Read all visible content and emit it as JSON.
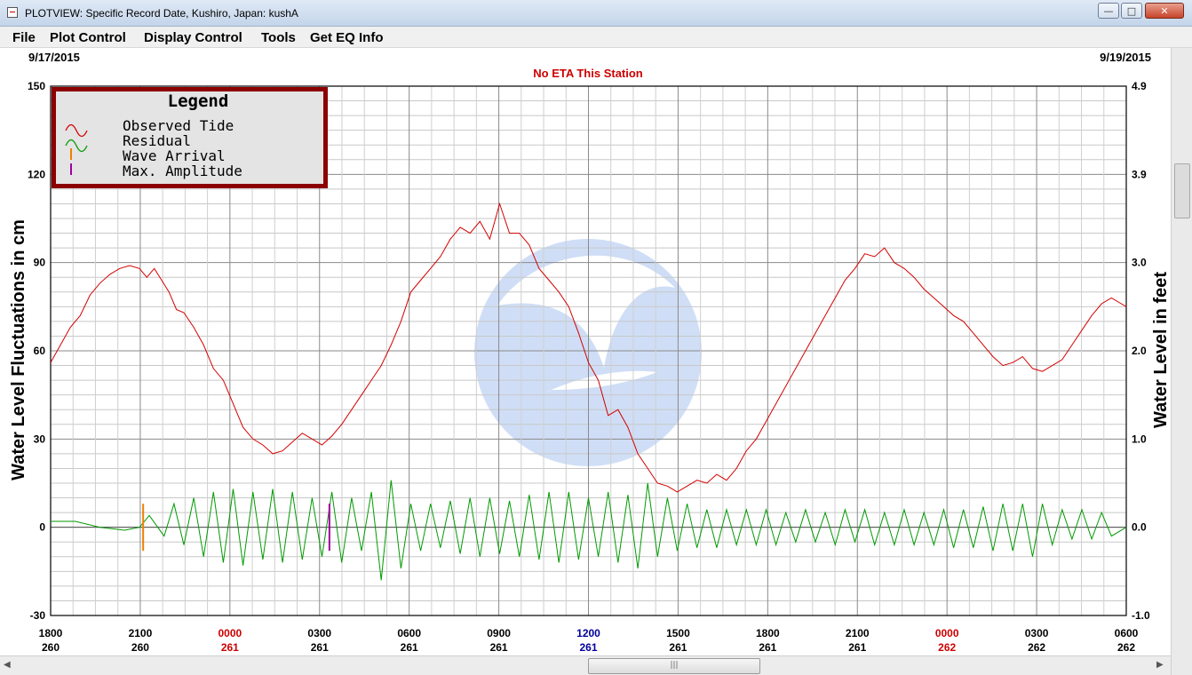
{
  "window": {
    "title": "PLOTVIEW: Specific Record Date, Kushiro, Japan: kushA",
    "buttons": {
      "minimize": "—",
      "maximize": "□",
      "close": "✕"
    }
  },
  "menu": [
    "File",
    "Plot Control",
    "Display Control",
    "Tools",
    "Get EQ Info"
  ],
  "header": {
    "date_start": "9/17/2015",
    "date_end": "9/19/2015",
    "status": "No ETA This Station"
  },
  "legend": {
    "title": "Legend",
    "items": [
      "Observed Tide",
      "Residual",
      "Wave Arrival",
      "Max. Amplitude"
    ]
  },
  "colors": {
    "observed": "#d40000",
    "residual": "#009a00",
    "wave_arrival": "#f08000",
    "max_amplitude": "#a000a0",
    "status_text": "#cc0000",
    "day_red": "#cc0000",
    "blue_tick": "#000099"
  },
  "chart_data": {
    "type": "line",
    "ylabel_left": "Water Level Fluctuations in cm",
    "ylabel_right": "Water Level in feet",
    "ylim_cm": [
      -30,
      150
    ],
    "ylim_ft": [
      -1.0,
      4.9
    ],
    "left_ticks": [
      "150",
      "120",
      "90",
      "60",
      "30",
      "0",
      "-30"
    ],
    "right_ticks": [
      "4.9",
      "3.9",
      "3.0",
      "2.0",
      "1.0",
      "0.0",
      "-1.0"
    ],
    "x_ticks": [
      {
        "time": "1800",
        "day": "260",
        "color": "black"
      },
      {
        "time": "2100",
        "day": "260",
        "color": "black"
      },
      {
        "time": "0000",
        "day": "261",
        "color": "red"
      },
      {
        "time": "0300",
        "day": "261",
        "color": "black"
      },
      {
        "time": "0600",
        "day": "261",
        "color": "black"
      },
      {
        "time": "0900",
        "day": "261",
        "color": "black"
      },
      {
        "time": "1200",
        "day": "261",
        "color": "blue"
      },
      {
        "time": "1500",
        "day": "261",
        "color": "black"
      },
      {
        "time": "1800",
        "day": "261",
        "color": "black"
      },
      {
        "time": "2100",
        "day": "261",
        "color": "black"
      },
      {
        "time": "0000",
        "day": "262",
        "color": "red"
      },
      {
        "time": "0300",
        "day": "262",
        "color": "black"
      },
      {
        "time": "0600",
        "day": "262",
        "color": "black"
      }
    ],
    "grid": true,
    "legend_position": "top-left",
    "x_unit_note": "hours after 1800 day 260",
    "series": [
      {
        "name": "Observed Tide",
        "points": [
          [
            0,
            56
          ],
          [
            0.4,
            62
          ],
          [
            0.8,
            68
          ],
          [
            1.2,
            72
          ],
          [
            1.6,
            79
          ],
          [
            2.0,
            83
          ],
          [
            2.4,
            86
          ],
          [
            2.8,
            88
          ],
          [
            3.2,
            89
          ],
          [
            3.6,
            88
          ],
          [
            3.9,
            85
          ],
          [
            4.2,
            88
          ],
          [
            4.5,
            84
          ],
          [
            4.8,
            80
          ],
          [
            5.1,
            74
          ],
          [
            5.4,
            73
          ],
          [
            5.8,
            68
          ],
          [
            6.2,
            62
          ],
          [
            6.6,
            54
          ],
          [
            7.0,
            50
          ],
          [
            7.4,
            42
          ],
          [
            7.8,
            34
          ],
          [
            8.2,
            30
          ],
          [
            8.6,
            28
          ],
          [
            9.0,
            25
          ],
          [
            9.4,
            26
          ],
          [
            9.8,
            29
          ],
          [
            10.2,
            32
          ],
          [
            10.6,
            30
          ],
          [
            11.0,
            28
          ],
          [
            11.4,
            31
          ],
          [
            11.8,
            35
          ],
          [
            12.2,
            40
          ],
          [
            12.6,
            45
          ],
          [
            13.0,
            50
          ],
          [
            13.4,
            55
          ],
          [
            13.8,
            62
          ],
          [
            14.2,
            70
          ],
          [
            14.6,
            80
          ],
          [
            15.0,
            84
          ],
          [
            15.4,
            88
          ],
          [
            15.8,
            92
          ],
          [
            16.2,
            98
          ],
          [
            16.6,
            102
          ],
          [
            17.0,
            100
          ],
          [
            17.4,
            104
          ],
          [
            17.8,
            98
          ],
          [
            18.2,
            110
          ],
          [
            18.6,
            100
          ],
          [
            19.0,
            100
          ],
          [
            19.4,
            96
          ],
          [
            19.8,
            88
          ],
          [
            20.2,
            84
          ],
          [
            20.6,
            80
          ],
          [
            21.0,
            75
          ],
          [
            21.4,
            66
          ],
          [
            21.8,
            56
          ],
          [
            22.2,
            50
          ],
          [
            22.6,
            38
          ],
          [
            23.0,
            40
          ],
          [
            23.4,
            34
          ],
          [
            23.8,
            25
          ],
          [
            24.2,
            20
          ],
          [
            24.6,
            15
          ],
          [
            25.0,
            14
          ],
          [
            25.4,
            12
          ],
          [
            25.8,
            14
          ],
          [
            26.2,
            16
          ],
          [
            26.6,
            15
          ],
          [
            27.0,
            18
          ],
          [
            27.4,
            16
          ],
          [
            27.8,
            20
          ],
          [
            28.2,
            26
          ],
          [
            28.6,
            30
          ],
          [
            29.0,
            36
          ],
          [
            29.4,
            42
          ],
          [
            29.8,
            48
          ],
          [
            30.2,
            54
          ],
          [
            30.6,
            60
          ],
          [
            31.0,
            66
          ],
          [
            31.4,
            72
          ],
          [
            31.8,
            78
          ],
          [
            32.2,
            84
          ],
          [
            32.6,
            88
          ],
          [
            33.0,
            93
          ],
          [
            33.4,
            92
          ],
          [
            33.8,
            95
          ],
          [
            34.2,
            90
          ],
          [
            34.6,
            88
          ],
          [
            35.0,
            85
          ],
          [
            35.4,
            81
          ],
          [
            35.8,
            78
          ],
          [
            36.2,
            75
          ],
          [
            36.6,
            72
          ],
          [
            37.0,
            70
          ],
          [
            37.4,
            66
          ],
          [
            37.8,
            62
          ],
          [
            38.2,
            58
          ],
          [
            38.6,
            55
          ],
          [
            39.0,
            56
          ],
          [
            39.4,
            58
          ],
          [
            39.8,
            54
          ],
          [
            40.2,
            53
          ],
          [
            40.6,
            55
          ],
          [
            41.0,
            57
          ],
          [
            41.4,
            62
          ],
          [
            41.8,
            67
          ],
          [
            42.2,
            72
          ],
          [
            42.6,
            76
          ],
          [
            43.0,
            78
          ],
          [
            43.4,
            76
          ],
          [
            43.6,
            75
          ]
        ]
      },
      {
        "name": "Residual",
        "points": [
          [
            0,
            2
          ],
          [
            1.0,
            2
          ],
          [
            2.0,
            0
          ],
          [
            3.0,
            -1
          ],
          [
            3.6,
            0
          ],
          [
            4.0,
            4
          ],
          [
            4.6,
            -3
          ],
          [
            5.0,
            8
          ],
          [
            5.4,
            -6
          ],
          [
            5.8,
            10
          ],
          [
            6.2,
            -10
          ],
          [
            6.6,
            12
          ],
          [
            7.0,
            -12
          ],
          [
            7.4,
            13
          ],
          [
            7.8,
            -13
          ],
          [
            8.2,
            12
          ],
          [
            8.6,
            -11
          ],
          [
            9.0,
            13
          ],
          [
            9.4,
            -12
          ],
          [
            9.8,
            12
          ],
          [
            10.2,
            -11
          ],
          [
            10.6,
            10
          ],
          [
            11.0,
            -10
          ],
          [
            11.4,
            12
          ],
          [
            11.8,
            -12
          ],
          [
            12.2,
            10
          ],
          [
            12.6,
            -8
          ],
          [
            13.0,
            12
          ],
          [
            13.4,
            -18
          ],
          [
            13.8,
            16
          ],
          [
            14.2,
            -14
          ],
          [
            14.6,
            8
          ],
          [
            15.0,
            -8
          ],
          [
            15.4,
            8
          ],
          [
            15.8,
            -7
          ],
          [
            16.2,
            9
          ],
          [
            16.6,
            -9
          ],
          [
            17.0,
            10
          ],
          [
            17.4,
            -10
          ],
          [
            17.8,
            10
          ],
          [
            18.2,
            -9
          ],
          [
            18.6,
            9
          ],
          [
            19.0,
            -10
          ],
          [
            19.4,
            11
          ],
          [
            19.8,
            -11
          ],
          [
            20.2,
            12
          ],
          [
            20.6,
            -12
          ],
          [
            21.0,
            12
          ],
          [
            21.4,
            -11
          ],
          [
            21.8,
            10
          ],
          [
            22.2,
            -10
          ],
          [
            22.6,
            12
          ],
          [
            23.0,
            -12
          ],
          [
            23.4,
            11
          ],
          [
            23.8,
            -14
          ],
          [
            24.2,
            15
          ],
          [
            24.6,
            -10
          ],
          [
            25.0,
            10
          ],
          [
            25.4,
            -8
          ],
          [
            25.8,
            8
          ],
          [
            26.2,
            -7
          ],
          [
            26.6,
            6
          ],
          [
            27.0,
            -7
          ],
          [
            27.4,
            6
          ],
          [
            27.8,
            -6
          ],
          [
            28.2,
            6
          ],
          [
            28.6,
            -6
          ],
          [
            29.0,
            6
          ],
          [
            29.4,
            -6
          ],
          [
            29.8,
            5
          ],
          [
            30.2,
            -5
          ],
          [
            30.6,
            6
          ],
          [
            31.0,
            -5
          ],
          [
            31.4,
            5
          ],
          [
            31.8,
            -6
          ],
          [
            32.2,
            6
          ],
          [
            32.6,
            -5
          ],
          [
            33.0,
            6
          ],
          [
            33.4,
            -6
          ],
          [
            33.8,
            5
          ],
          [
            34.2,
            -6
          ],
          [
            34.6,
            6
          ],
          [
            35.0,
            -6
          ],
          [
            35.4,
            5
          ],
          [
            35.8,
            -6
          ],
          [
            36.2,
            6
          ],
          [
            36.6,
            -7
          ],
          [
            37.0,
            6
          ],
          [
            37.4,
            -7
          ],
          [
            37.8,
            7
          ],
          [
            38.2,
            -8
          ],
          [
            38.6,
            8
          ],
          [
            39.0,
            -8
          ],
          [
            39.4,
            8
          ],
          [
            39.8,
            -10
          ],
          [
            40.2,
            8
          ],
          [
            40.6,
            -6
          ],
          [
            41.0,
            6
          ],
          [
            41.4,
            -4
          ],
          [
            41.8,
            6
          ],
          [
            42.2,
            -4
          ],
          [
            42.6,
            5
          ],
          [
            43.0,
            -3
          ],
          [
            43.6,
            0
          ]
        ]
      }
    ],
    "markers": {
      "wave_arrival_x": 3.75,
      "max_amplitude_x": 11.3
    }
  }
}
